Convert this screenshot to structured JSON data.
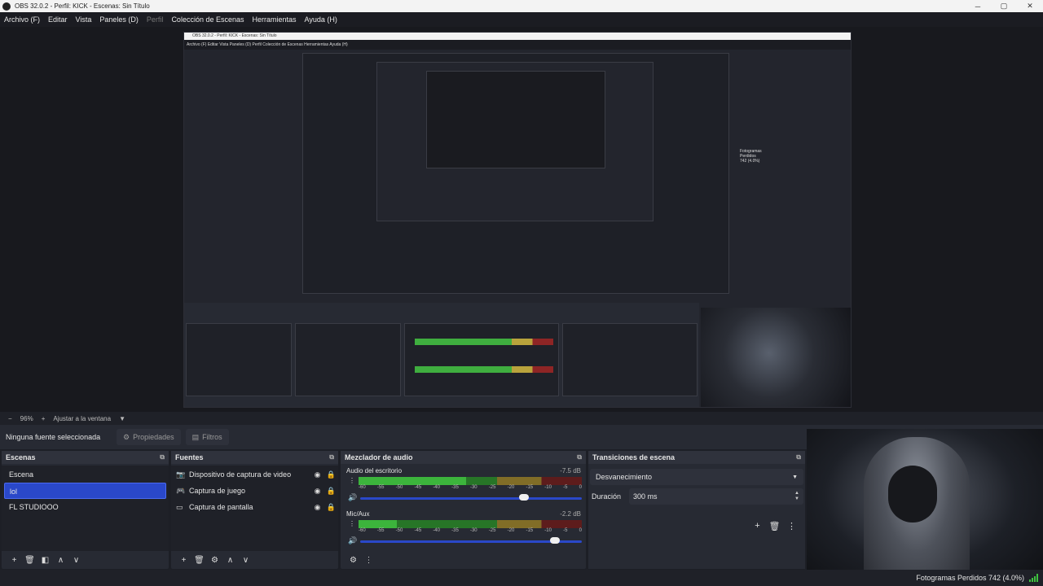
{
  "window": {
    "title": "OBS 32.0.2 - Perfil: KICK - Escenas: Sin Título",
    "minimize": "─",
    "maximize": "▢",
    "close": "✕"
  },
  "menu": {
    "items": [
      "Archivo (F)",
      "Editar",
      "Vista",
      "Paneles (D)",
      "Perfil",
      "Colección de Escenas",
      "Herramientas",
      "Ayuda (H)"
    ]
  },
  "preview": {
    "nested_title": "OBS 32.0.2 - Perfil: KICK - Escenas: Sin Título",
    "nested_menu": "Archivo (F)   Editar   Vista   Paneles (D)   Perfil   Colección de Escenas   Herramientas   Ayuda (H)",
    "nested_fps": "Fotogramas Perdidos 742 (4.0%)"
  },
  "zoom": {
    "minus": "−",
    "level": "96%",
    "plus": "+",
    "fit": "Ajustar a la ventana",
    "caret": "▼"
  },
  "properties_bar": {
    "no_source": "Ninguna fuente seleccionada",
    "properties_icon": "gear-icon",
    "properties": "Propiedades",
    "filters_icon": "filter-icon",
    "filters": "Filtros"
  },
  "scenes": {
    "title": "Escenas",
    "items": [
      "Escena",
      "lol",
      "FL STUDIOOO"
    ],
    "active_index": 1
  },
  "sources": {
    "title": "Fuentes",
    "items": [
      {
        "name": "Dispositivo de captura de video",
        "icon": "camera-icon"
      },
      {
        "name": "Captura de juego",
        "icon": "gamepad-icon"
      },
      {
        "name": "Captura de pantalla",
        "icon": "monitor-icon"
      }
    ]
  },
  "mixer": {
    "title": "Mezclador de audio",
    "channels": [
      {
        "name": "Audio del escritorio",
        "db": "-7.5 dB",
        "level": 0.48,
        "volume": 0.74
      },
      {
        "name": "Mic/Aux",
        "db": "-2.2 dB",
        "level": 0.17,
        "volume": 0.88
      }
    ],
    "ticks": [
      "-60",
      "-55",
      "-50",
      "-45",
      "-40",
      "-35",
      "-30",
      "-25",
      "-20",
      "-15",
      "-10",
      "-5",
      "0"
    ]
  },
  "transitions": {
    "title": "Transiciones de escena",
    "selected": "Desvanecimiento",
    "duration_label": "Duración",
    "duration_value": "300 ms"
  },
  "status": {
    "dropped_frames": "Fotogramas Perdidos 742 (4.0%)"
  },
  "colors": {
    "accent": "#2a48c9",
    "meter_green": "#3cb43c",
    "meter_yellow": "#c6a83c",
    "meter_red": "#8f2b2b"
  }
}
